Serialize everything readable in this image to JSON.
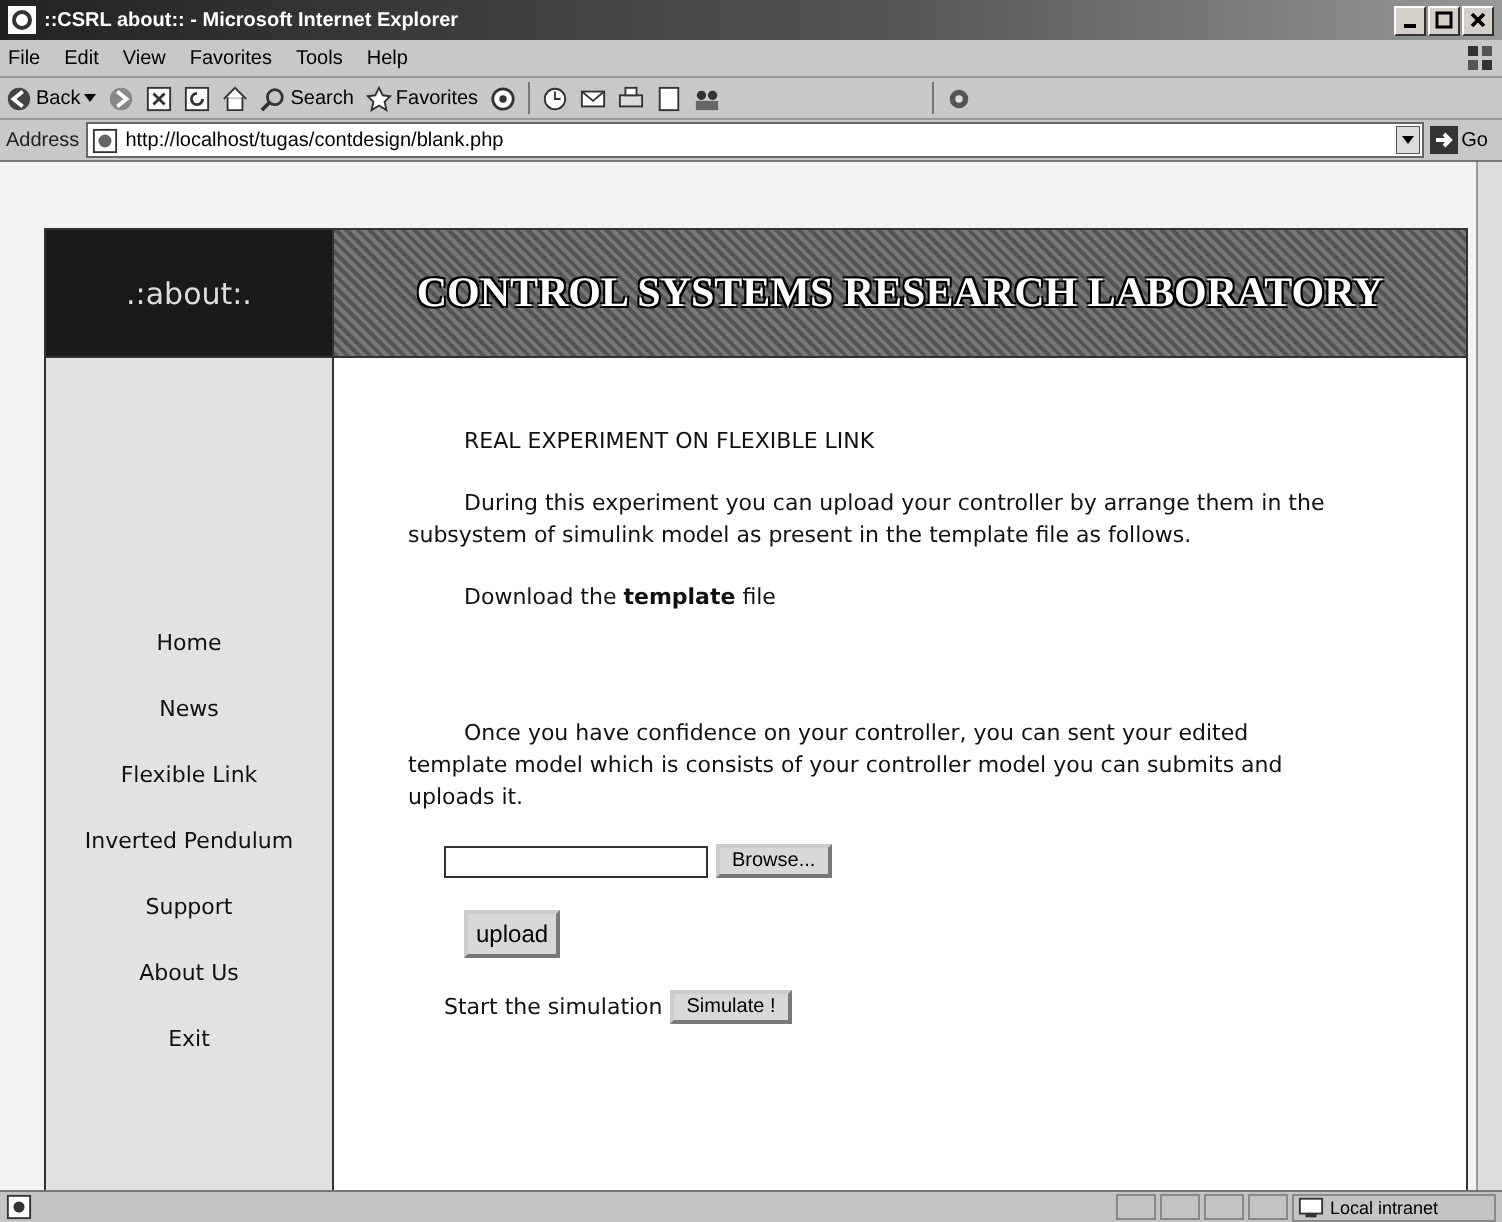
{
  "window": {
    "title": "::CSRL about:: - Microsoft Internet Explorer"
  },
  "menu_bar": [
    "File",
    "Edit",
    "View",
    "Favorites",
    "Tools",
    "Help"
  ],
  "toolbar": {
    "back": "Back",
    "search": "Search",
    "favorites": "Favorites"
  },
  "address_bar": {
    "label": "Address",
    "url": "http://localhost/tugas/contdesign/blank.php",
    "go": "Go"
  },
  "page": {
    "logo": ".:about:.",
    "header_title": "CONTROL SYSTEMS RESEARCH LABORATORY",
    "nav": [
      "Home",
      "News",
      "Flexible Link",
      "Inverted Pendulum",
      "Support",
      "About Us",
      "Exit"
    ],
    "heading": "REAL EXPERIMENT ON FLEXIBLE LINK",
    "intro": "During this experiment you can upload your controller by arrange them in the subsystem of simulink model as present in the template file as follows.",
    "download": "Download the **template** file",
    "instructions": "Once you have confidence on your controller, you can sent your edited template model which is consists of your controller model you can submits and uploads it.",
    "browse_label": "Browse...",
    "upload_label": "upload",
    "simulate_prefix": "Start the simulation",
    "simulate_label": "Simulate !"
  },
  "status_bar": {
    "zone": "Local intranet"
  }
}
